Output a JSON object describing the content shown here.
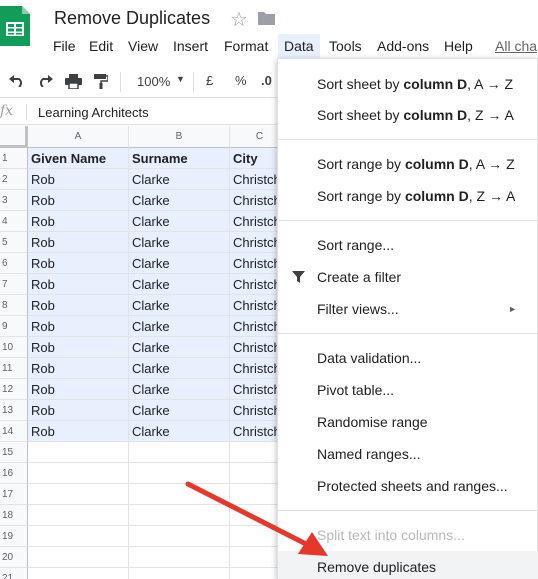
{
  "doc": {
    "title": "Remove Duplicates"
  },
  "menubar": {
    "items": [
      "File",
      "Edit",
      "View",
      "Insert",
      "Format",
      "Data",
      "Tools",
      "Add-ons",
      "Help",
      "All cha"
    ]
  },
  "toolbar": {
    "zoom": "100%",
    "currency": "£",
    "percent": "%",
    "decimal": ".0"
  },
  "formula": {
    "fx_label": "fx",
    "content": "Learning Architects"
  },
  "sheet": {
    "columns": [
      "A",
      "B",
      "C"
    ],
    "row_numbers": [
      "1",
      "2",
      "3",
      "4",
      "5",
      "6",
      "7",
      "8",
      "9",
      "10",
      "11",
      "12",
      "13",
      "14",
      "15",
      "16",
      "17",
      "18",
      "19",
      "20",
      "21"
    ],
    "header_row": [
      "Given Name",
      "Surname",
      "City"
    ],
    "data_rows": [
      [
        "Rob",
        "Clarke",
        "Christch"
      ],
      [
        "Rob",
        "Clarke",
        "Christch"
      ],
      [
        "Rob",
        "Clarke",
        "Christch"
      ],
      [
        "Rob",
        "Clarke",
        "Christch"
      ],
      [
        "Rob",
        "Clarke",
        "Christch"
      ],
      [
        "Rob",
        "Clarke",
        "Christch"
      ],
      [
        "Rob",
        "Clarke",
        "Christch"
      ],
      [
        "Rob",
        "Clarke",
        "Christch"
      ],
      [
        "Rob",
        "Clarke",
        "Christch"
      ],
      [
        "Rob",
        "Clarke",
        "Christch"
      ],
      [
        "Rob",
        "Clarke",
        "Christch"
      ],
      [
        "Rob",
        "Clarke",
        "Christch"
      ],
      [
        "Rob",
        "Clarke",
        "Christch"
      ]
    ]
  },
  "data_menu": {
    "sort_sheet_az": {
      "pre": "Sort sheet by ",
      "col": "column D",
      "post": ", A → Z"
    },
    "sort_sheet_za": {
      "pre": "Sort sheet by ",
      "col": "column D",
      "post": ", Z → A"
    },
    "sort_range_az": {
      "pre": "Sort range by ",
      "col": "column D",
      "post": ", A → Z"
    },
    "sort_range_za": {
      "pre": "Sort range by ",
      "col": "column D",
      "post": ", Z → A"
    },
    "sort_range": "Sort range...",
    "create_filter": "Create a filter",
    "filter_views": "Filter views...",
    "data_validation": "Data validation...",
    "pivot_table": "Pivot table...",
    "randomise_range": "Randomise range",
    "named_ranges": "Named ranges...",
    "protected": "Protected sheets and ranges...",
    "split_text": "Split text into columns...",
    "remove_duplicates": "Remove duplicates",
    "submenu_arrow": "►"
  },
  "colors": {
    "selection": "#e8f0fe",
    "arrow": "#e8362b",
    "sheets_green": "#0f9d58"
  }
}
